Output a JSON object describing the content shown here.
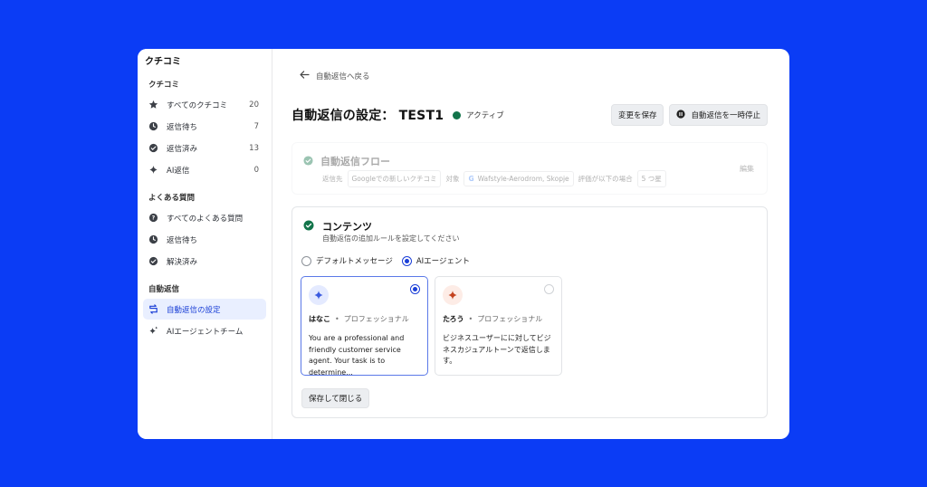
{
  "app": {
    "brand": "クチコミ"
  },
  "sidebar": {
    "sections": [
      {
        "title": "クチコミ",
        "items": [
          {
            "label": "すべてのクチコミ",
            "count": "20",
            "icon": "star-icon"
          },
          {
            "label": "返信待ち",
            "count": "7",
            "icon": "clock-icon"
          },
          {
            "label": "返信済み",
            "count": "13",
            "icon": "check-circle-icon"
          },
          {
            "label": "AI返信",
            "count": "0",
            "icon": "sparkle-icon"
          }
        ]
      },
      {
        "title": "よくある質問",
        "items": [
          {
            "label": "すべてのよくある質問",
            "icon": "question-icon"
          },
          {
            "label": "返信待ち",
            "icon": "clock-icon"
          },
          {
            "label": "解決済み",
            "icon": "check-circle-icon"
          }
        ]
      },
      {
        "title": "自動返信",
        "items": [
          {
            "label": "自動返信の設定",
            "icon": "auto-reply-icon"
          },
          {
            "label": "AIエージェントチーム",
            "icon": "sparkles-icon"
          }
        ]
      }
    ]
  },
  "main": {
    "back_label": "自動返信へ戻る",
    "title": "自動返信の設定： TEST1",
    "status": "アクティブ",
    "save_label": "変更を保存",
    "pause_label": "自動返信を一時停止",
    "flow": {
      "title": "自動返信フロー",
      "edit": "編集",
      "reply_to_label": "返信先",
      "reply_to_value": "Googleでの新しいクチコミ",
      "target_label": "対象",
      "target_value": "Wafstyle-Aerodrom, Skopje",
      "rating_label": "評価が以下の場合",
      "rating_value": "5 つ星"
    },
    "content": {
      "title": "コンテンツ",
      "subtitle": "自動返信の追加ルールを設定してください",
      "option_default": "デフォルトメッセージ",
      "option_ai": "AIエージェント",
      "agents": [
        {
          "name": "はなこ",
          "role": "プロフェッショナル",
          "desc": "You are a professional and friendly customer service agent. Your task is to determine...",
          "selected": true,
          "color": "#3b5be0"
        },
        {
          "name": "たろう",
          "role": "プロフェッショナル",
          "desc": "ビジネスユーザーにに対してビジネスカジュアルトーンで返信します。",
          "selected": false,
          "color": "#c4431f"
        }
      ],
      "save_close": "保存して閉じる"
    }
  },
  "colors": {
    "background": "#0b3cf5",
    "accent": "#1b3fd8",
    "active": "#12744a"
  }
}
